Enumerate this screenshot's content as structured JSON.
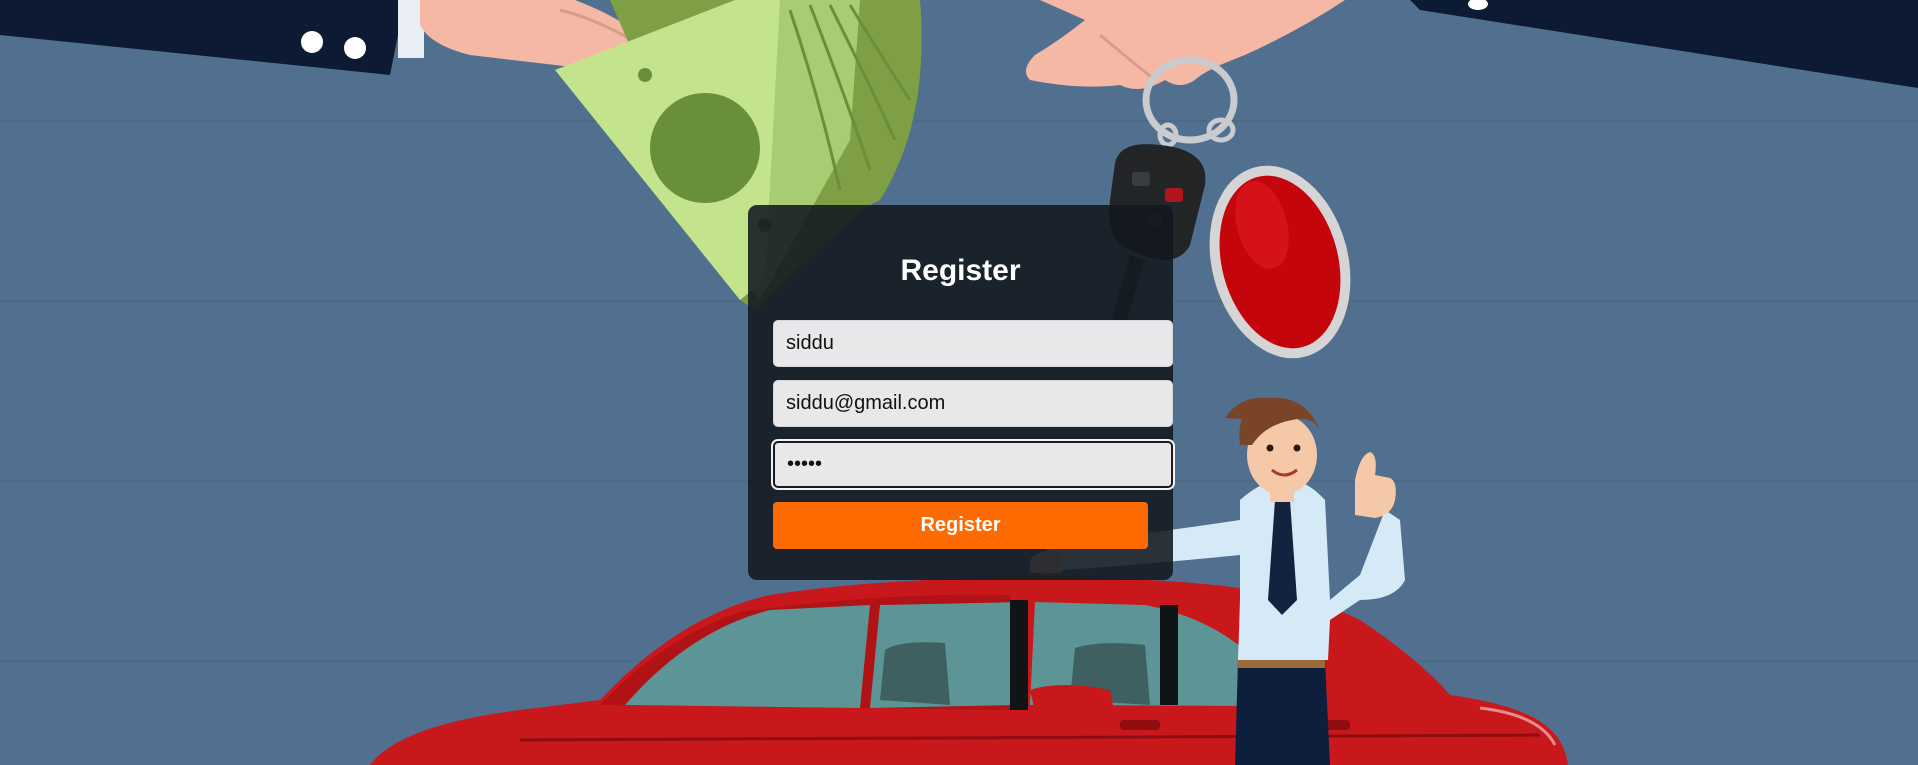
{
  "page": {
    "background_color": "#51708f"
  },
  "form": {
    "title": "Register",
    "username": {
      "value": "siddu"
    },
    "email": {
      "value": "siddu@gmail.com"
    },
    "password": {
      "value": "•••••",
      "type": "password",
      "focused": true
    },
    "submit_label": "Register",
    "accent_color": "#ff6a00"
  },
  "illustration": {
    "elements": [
      "hand-with-money",
      "hand-with-car-key",
      "car-key-icon",
      "red-keychain",
      "salesman",
      "red-car"
    ]
  }
}
